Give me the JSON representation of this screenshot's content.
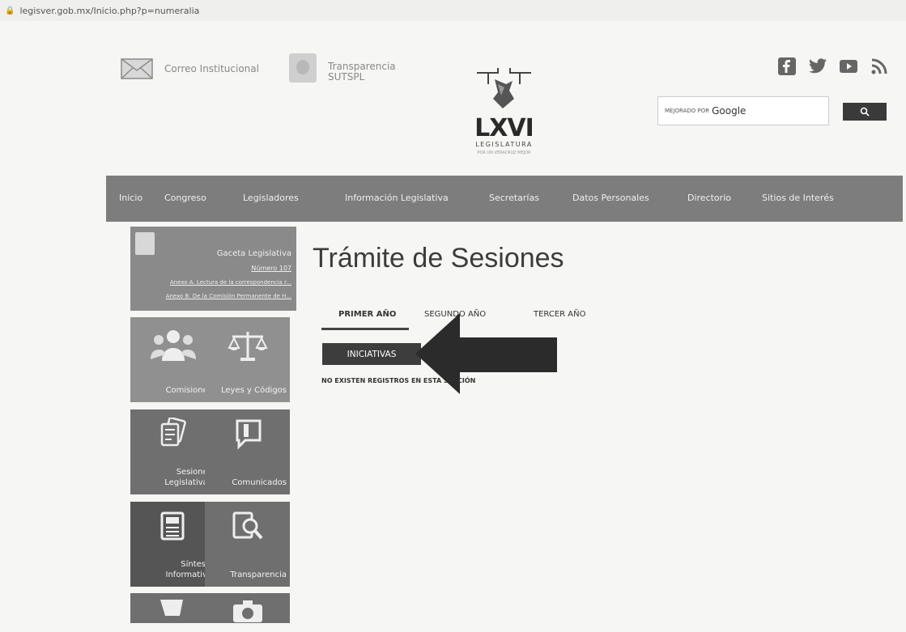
{
  "browser": {
    "url": "legisver.gob.mx/Inicio.php?p=numeralia"
  },
  "header": {
    "mail_label": "Correo Institucional",
    "transparencia_label": "Transparencia\nSUTSPL",
    "logo": {
      "main": "LXVI",
      "sub": "LEGISLATURA",
      "tag": "POR UN VERACRUZ MEJOR"
    },
    "social_icons": [
      "facebook-icon",
      "twitter-icon",
      "youtube-icon",
      "rss-icon"
    ],
    "search": {
      "prefix": "MEJORADO POR",
      "brand": "Google",
      "button_icon": "search-icon"
    }
  },
  "nav": {
    "items": [
      "Inicio",
      "Congreso",
      "Legisladores",
      "Información Legislativa",
      "Secretarías",
      "Datos Personales",
      "Directorio",
      "Sitios de Interés"
    ]
  },
  "sidebar": {
    "gaceta": {
      "title": "Gaceta Legislativa",
      "number": "Número 107",
      "link1": "Anexo A. Lectura de la correspondencia r...",
      "link2": "Anexo B. De la Comisión Permanente de H..."
    },
    "tiles": [
      {
        "label": "Comisiones",
        "icon": "people-icon"
      },
      {
        "label": "Leyes y Códigos",
        "icon": "scales-icon"
      },
      {
        "label": "Sesiones Legislativas",
        "icon": "documents-icon"
      },
      {
        "label": "Comunicados",
        "icon": "speech-icon"
      },
      {
        "label": "Síntesis Informativa",
        "icon": "newspaper-icon"
      },
      {
        "label": "Transparencia",
        "icon": "magnifier-doc-icon"
      },
      {
        "label": "",
        "icon": "cart-icon"
      },
      {
        "label": "",
        "icon": "camera-icon"
      }
    ]
  },
  "main": {
    "title": "Trámite de Sesiones",
    "tabs": [
      "PRIMER AÑO",
      "SEGUNDO AÑO",
      "TERCER AÑO"
    ],
    "active_tab": "PRIMER AÑO",
    "button": "INICIATIVAS",
    "empty_message": "NO EXISTEN REGISTROS EN ESTA SECCIÓN"
  },
  "colors": {
    "nav": "#7d7d7d",
    "tile": "#909090",
    "button": "#3d3d3d",
    "arrow": "#2b2b2b"
  }
}
